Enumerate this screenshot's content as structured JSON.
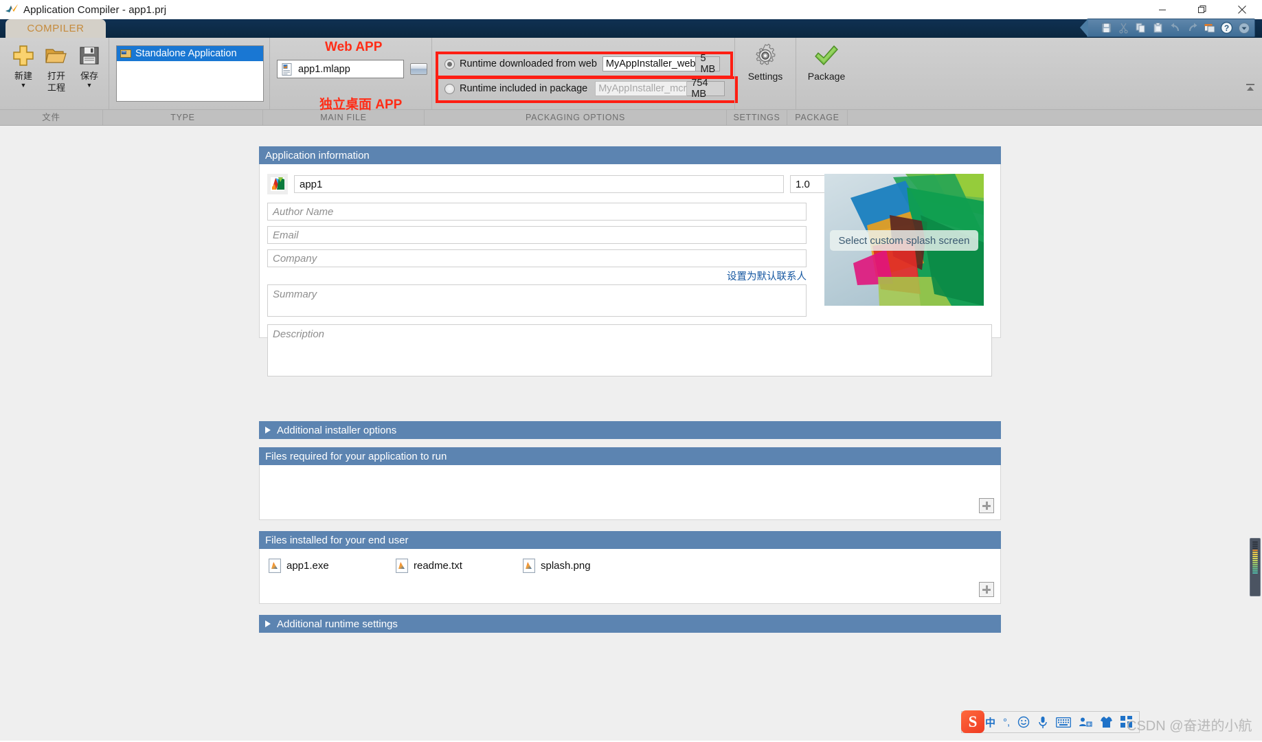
{
  "window": {
    "title": "Application Compiler - app1.prj",
    "app_icon": "matlab-icon",
    "controls": [
      {
        "name": "minimize-button",
        "glyph": "—"
      },
      {
        "name": "maximize-button",
        "glyph": "❐"
      },
      {
        "name": "close-button",
        "glyph": "✕"
      }
    ]
  },
  "ribbon": {
    "tab": "COMPILER",
    "quick_access": [
      {
        "name": "save-icon",
        "label": "Save"
      },
      {
        "name": "cut-icon",
        "label": "Cut"
      },
      {
        "name": "copy-icon",
        "label": "Copy"
      },
      {
        "name": "paste-icon",
        "label": "Paste"
      },
      {
        "name": "undo-icon",
        "label": "Undo"
      },
      {
        "name": "redo-icon",
        "label": "Redo"
      },
      {
        "name": "layout-icon",
        "label": "Layout"
      },
      {
        "name": "help-icon",
        "label": "Help"
      },
      {
        "name": "more-icon",
        "label": "More"
      }
    ],
    "groups": {
      "file": {
        "label": "文件",
        "buttons": [
          {
            "name": "new-project-button",
            "label": "新建",
            "label2": "",
            "arrow": "▼",
            "icon": "plus-icon"
          },
          {
            "name": "open-project-button",
            "label": "打开",
            "label2": "工程",
            "arrow": "",
            "icon": "folder-icon"
          },
          {
            "name": "save-project-button",
            "label": "保存",
            "label2": "",
            "arrow": "▼",
            "icon": "floppy-icon"
          }
        ]
      },
      "type": {
        "label": "TYPE",
        "selected": "Standalone Application"
      },
      "main_file": {
        "label": "MAIN FILE",
        "file": "app1.mlapp",
        "annotation_top": "Web APP",
        "annotation_bottom": "独立桌面 APP"
      },
      "packaging": {
        "label": "PACKAGING OPTIONS",
        "options": [
          {
            "name": "runtime-web-option",
            "label": "Runtime downloaded from web",
            "installer_name": "MyAppInstaller_web",
            "size": "5 MB",
            "selected": true,
            "enabled": true
          },
          {
            "name": "runtime-included-option",
            "label": "Runtime included in package",
            "installer_name": "MyAppInstaller_mcr",
            "size": "754 MB",
            "selected": false,
            "enabled": false
          }
        ]
      },
      "settings": {
        "label": "SETTINGS",
        "button": "Settings",
        "icon": "gear-icon"
      },
      "package": {
        "label": "PACKAGE",
        "button": "Package",
        "icon": "checkmark-icon"
      }
    }
  },
  "main": {
    "app_info": {
      "title": "Application information",
      "app_name": "app1",
      "version": "1.0",
      "author_placeholder": "Author Name",
      "author_value": "",
      "email_placeholder": "Email",
      "email_value": "",
      "company_placeholder": "Company",
      "company_value": "",
      "default_contact_link": "设置为默认联系人",
      "summary_placeholder": "Summary",
      "summary_value": "",
      "description_placeholder": "Description",
      "description_value": "",
      "splash_button": "Select custom splash screen"
    },
    "additional_installer": {
      "title": "Additional installer options",
      "collapsed": true
    },
    "files_required": {
      "title": "Files required for your application to run",
      "files": [],
      "add_button": "add-required-file-button"
    },
    "files_installed": {
      "title": "Files installed for your end user",
      "files": [
        "app1.exe",
        "readme.txt",
        "splash.png"
      ],
      "add_button": "add-installed-file-button"
    },
    "additional_runtime": {
      "title": "Additional runtime settings",
      "collapsed": true
    }
  },
  "ime": {
    "logo": "S",
    "items": [
      "中",
      "°,",
      "☺",
      "mic",
      "keyboard",
      "toolbox",
      "skin",
      "apps"
    ]
  },
  "watermark": "CSDN @奋进的小航",
  "colors": {
    "ribbon_dark": "#0c2d4a",
    "tab_text": "#c58a3b",
    "panel_header": "#5c84b1",
    "selection_blue": "#1977d3",
    "annotation_red": "#ff2d17",
    "link_blue": "#1456a0"
  }
}
